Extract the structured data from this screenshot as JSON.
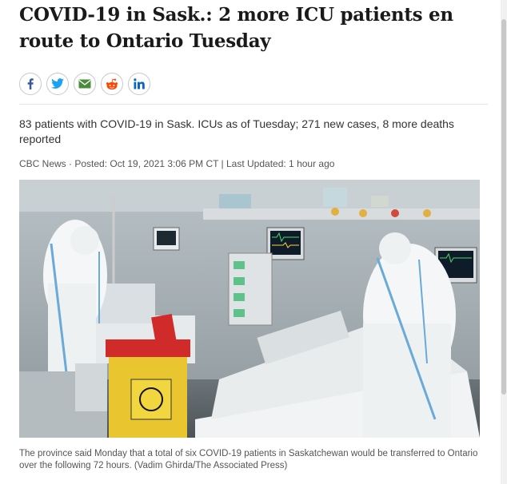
{
  "article": {
    "headline": "COVID-19 in Sask.: 2 more ICU patients en route to Ontario Tuesday",
    "deck": "83 patients with COVID-19 in Sask. ICUs as of Tuesday; 271 new cases, 8 more deaths reported",
    "byline": "CBC News · Posted: Oct 19, 2021 3:06 PM CT | Last Updated: 1 hour ago",
    "caption": "The province said Monday that a total of six COVID-19 patients in Saskatchewan would be transferred to Ontario over the following 72 hours. (Vadim Ghirda/The Associated Press)"
  },
  "share": [
    {
      "name": "facebook",
      "icon": "facebook-icon",
      "color": "#3b5998"
    },
    {
      "name": "twitter",
      "icon": "twitter-icon",
      "color": "#1da1f2"
    },
    {
      "name": "email",
      "icon": "email-icon",
      "color": "#4a8c3a"
    },
    {
      "name": "reddit",
      "icon": "reddit-icon",
      "color": "#ff4500"
    },
    {
      "name": "linkedin",
      "icon": "linkedin-icon",
      "color": "#0a66c2"
    }
  ]
}
